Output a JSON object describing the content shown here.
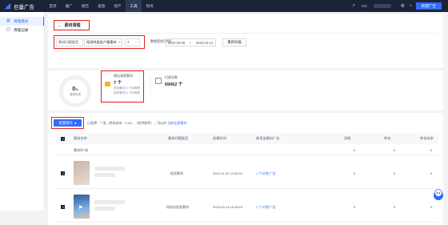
{
  "topbar": {
    "brand": "巨量广告",
    "nav": [
      "首页",
      "推广",
      "报告",
      "投放",
      "资产",
      "工具",
      "财务"
    ],
    "active_nav_index": 5,
    "language": "CN",
    "new_ad_label": "新建广告"
  },
  "sidebar": {
    "items": [
      {
        "label": "清理模式",
        "active": true,
        "icon": "broom-icon"
      },
      {
        "label": "清理记录",
        "active": false,
        "icon": "record-icon"
      }
    ]
  },
  "header": {
    "back_label": "素材清理"
  },
  "filters": {
    "type_placeholder": "素材问题类型",
    "type_value": "现游戏类低产量素材",
    "count_value": "3",
    "date_label": "数据指标时间",
    "date_start": "2023-03-08",
    "date_sep": "~",
    "date_end": "2023-03-14",
    "reset_label": "重新扫描"
  },
  "stats": {
    "ring_value": "0",
    "ring_unit": "%",
    "ring_label": "清理进度",
    "issue_title": "概括清理素材",
    "issue_count": "7 个",
    "issue_line1_prefix": "低效素材",
    "issue_line1_count": "0",
    "issue_line1_suffix": "个待清理",
    "issue_line2_prefix": "低质素材",
    "issue_line2_count": "0",
    "issue_line2_suffix": "个待清理",
    "scan_title": "扫描总数",
    "scan_count": "69062 个"
  },
  "table": {
    "bulk_label": "批量操作",
    "selected_prefix": "已选择：",
    "selected_count": "7 项",
    "selected_suffix": "，转化成本：0.00，（仅供参考），可以对",
    "selected_link": "当前全部素材",
    "columns": [
      "素材名称",
      "素材问题类型",
      "创建时间",
      "使用该素材广告",
      "消耗",
      "转化",
      "转化成本"
    ],
    "summary_label": "素材共7条",
    "summary_values": [
      "0",
      "0",
      "0"
    ],
    "rows": [
      {
        "type": "低质素材",
        "created": "2022-11-22 13:03:34",
        "ads": "1 个计划/广告",
        "cost": "0",
        "conv": "0",
        "cpa": "0",
        "thumb_colors": [
          "#c9b6a8",
          "#e8d9cf"
        ]
      },
      {
        "type": "同质化低效素材",
        "created": "2023-03-13 19:48:19",
        "ads": "1 个计划/广告",
        "cost": "0",
        "conv": "0",
        "cpa": "0",
        "thumb_colors": [
          "#2b5a9c",
          "#7fb0e6"
        ]
      }
    ]
  },
  "colors": {
    "accent": "#2f6bff",
    "highlight_border": "#e0241b",
    "topbar_bg": "#1b2337"
  }
}
